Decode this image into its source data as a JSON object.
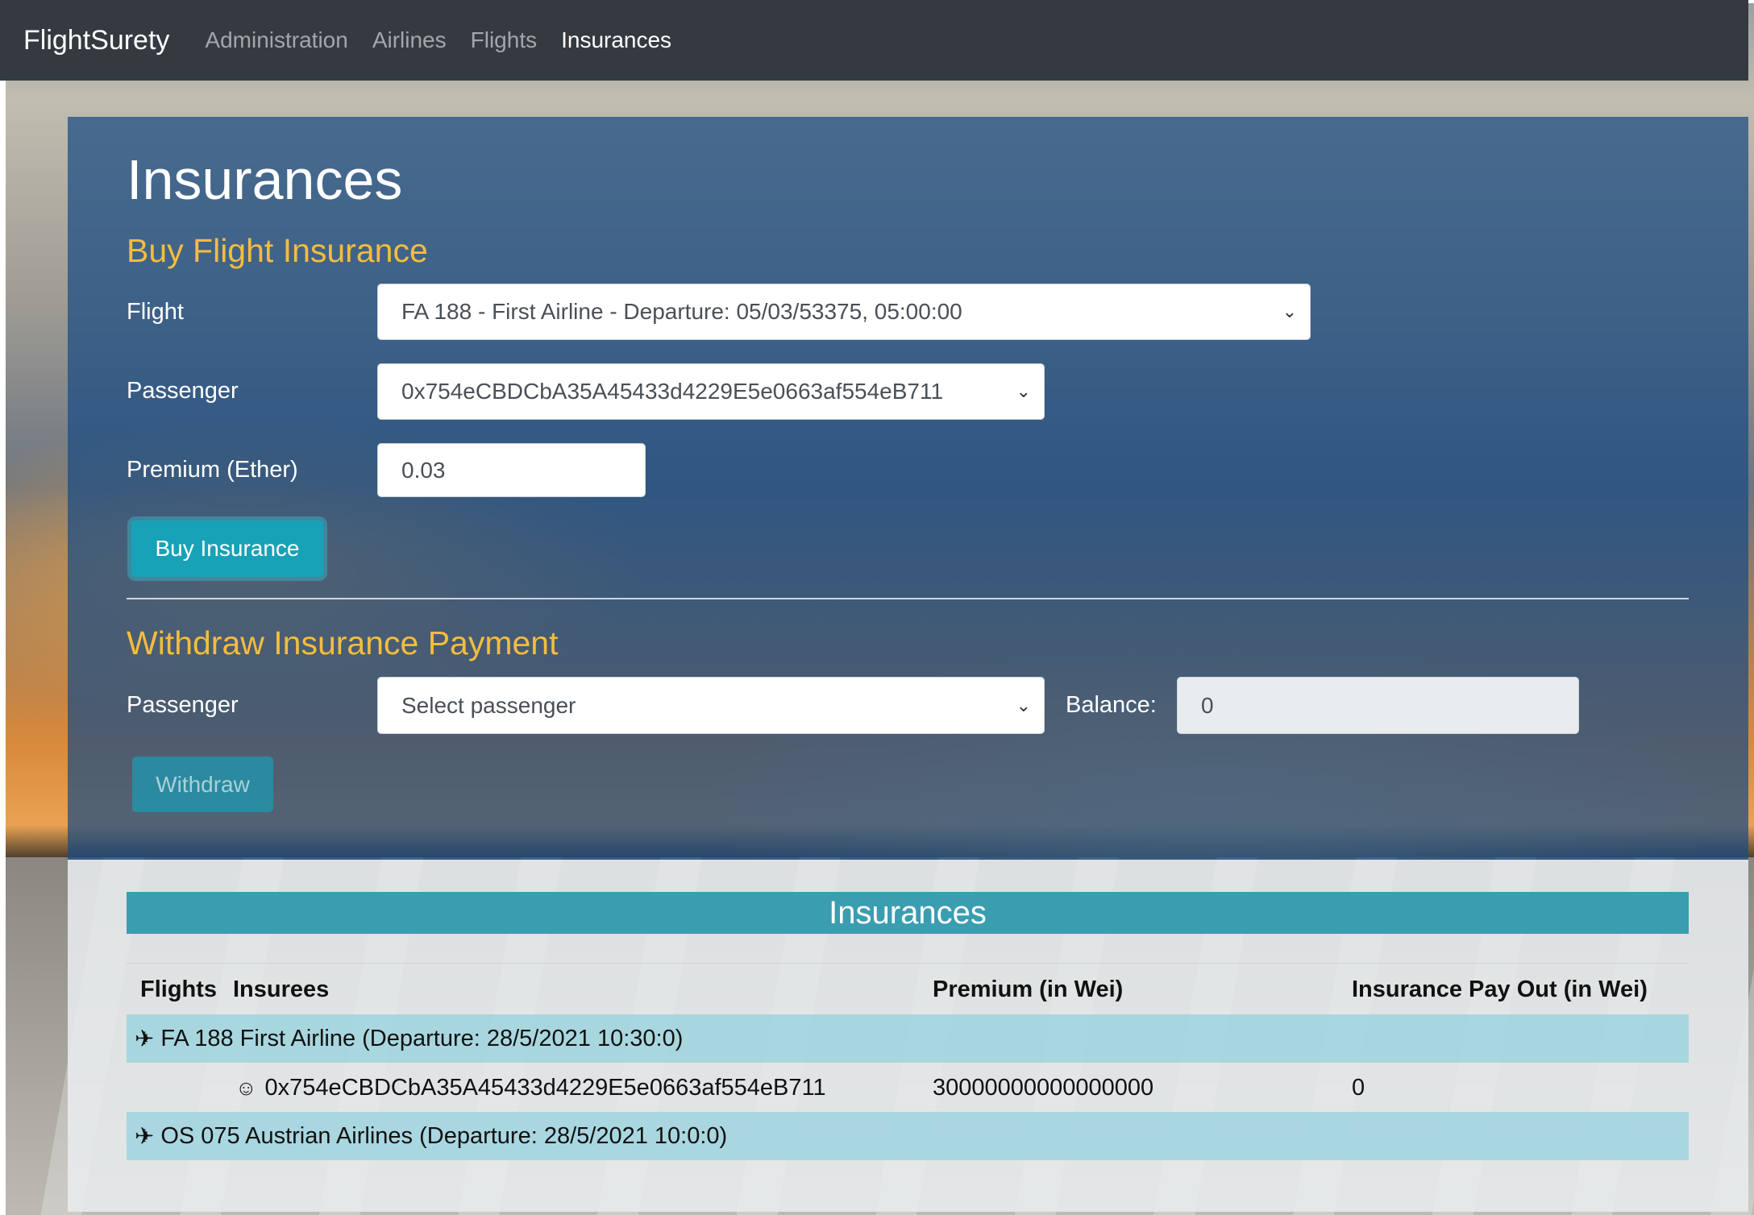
{
  "navbar": {
    "brand": "FlightSurety",
    "links": [
      "Administration",
      "Airlines",
      "Flights",
      "Insurances"
    ],
    "active": "Insurances"
  },
  "page_title": "Insurances",
  "buy": {
    "heading": "Buy Flight Insurance",
    "flight_label": "Flight",
    "flight_value": "FA 188 - First Airline - Departure: 05/03/53375, 05:00:00",
    "passenger_label": "Passenger",
    "passenger_value": "0x754eCBDCbA35A45433d4229E5e0663af554eB711",
    "premium_label": "Premium (Ether)",
    "premium_value": "0.03",
    "button": "Buy Insurance"
  },
  "withdraw": {
    "heading": "Withdraw Insurance Payment",
    "passenger_label": "Passenger",
    "passenger_value": "Select passenger",
    "balance_label": "Balance:",
    "balance_value": "0",
    "button": "Withdraw"
  },
  "table": {
    "title": "Insurances",
    "headers": [
      "Flights",
      "Insurees",
      "Premium (in Wei)",
      "Insurance Pay Out (in Wei)"
    ],
    "flights": [
      {
        "label": "FA 188 First Airline (Departure: 28/5/2021 10:30:0)",
        "insurees": [
          {
            "address": "0x754eCBDCbA35A45433d4229E5e0663af554eB711",
            "premium": "30000000000000000",
            "payout": "0"
          }
        ]
      },
      {
        "label": "OS 075 Austrian Airlines (Departure: 28/5/2021 10:0:0)",
        "insurees": []
      }
    ]
  },
  "icons": {
    "plane": "✈",
    "person": "☺",
    "chevron": "⌄"
  },
  "colors": {
    "navbar": "#343a40",
    "accent_heading": "#f4bd3c",
    "button": "#17a2b8",
    "table_title": "#3a9db0"
  }
}
